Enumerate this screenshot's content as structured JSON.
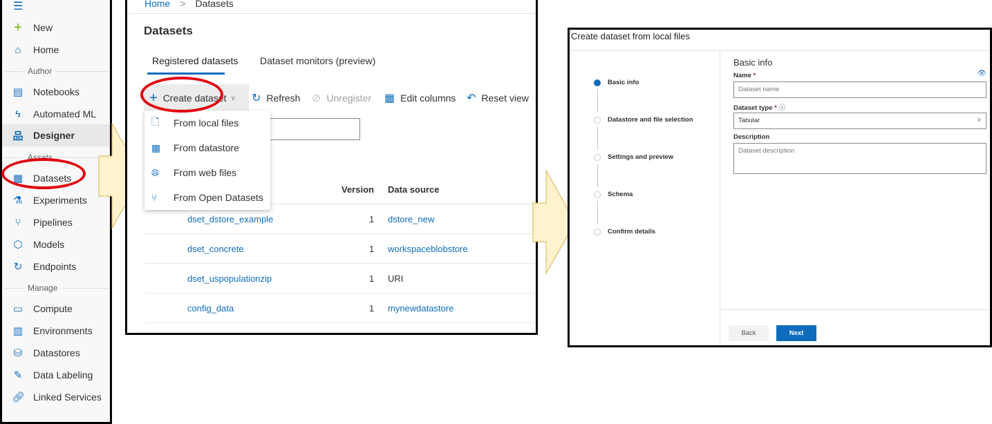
{
  "sidebar": {
    "items": [
      {
        "label": "New",
        "icon": "plus-icon"
      },
      {
        "label": "Home",
        "icon": "home-icon"
      },
      {
        "label": "Notebooks",
        "icon": "notebook-icon"
      },
      {
        "label": "Automated ML",
        "icon": "automl-icon"
      },
      {
        "label": "Designer",
        "icon": "designer-icon"
      },
      {
        "label": "Datasets",
        "icon": "datasets-icon"
      },
      {
        "label": "Experiments",
        "icon": "flask-icon"
      },
      {
        "label": "Pipelines",
        "icon": "pipeline-icon"
      },
      {
        "label": "Models",
        "icon": "cube-icon"
      },
      {
        "label": "Endpoints",
        "icon": "endpoint-icon"
      },
      {
        "label": "Compute",
        "icon": "monitor-icon"
      },
      {
        "label": "Environments",
        "icon": "environment-icon"
      },
      {
        "label": "Datastores",
        "icon": "database-icon"
      },
      {
        "label": "Data Labeling",
        "icon": "label-icon"
      },
      {
        "label": "Linked Services",
        "icon": "link-icon"
      }
    ],
    "sections": {
      "author": "Author",
      "assets": "Assets",
      "manage": "Manage"
    }
  },
  "breadcrumb": {
    "home": "Home",
    "sep": ">",
    "current": "Datasets"
  },
  "main": {
    "title": "Datasets",
    "tabs": [
      {
        "label": "Registered datasets"
      },
      {
        "label": "Dataset monitors (preview)"
      }
    ],
    "toolbar": {
      "create": "Create dataset",
      "refresh": "Refresh",
      "unregister": "Unregister",
      "edit_columns": "Edit columns",
      "reset_view": "Reset view"
    },
    "create_menu": [
      {
        "label": "From local files"
      },
      {
        "label": "From datastore"
      },
      {
        "label": "From web files"
      },
      {
        "label": "From Open Datasets"
      }
    ],
    "table": {
      "columns": {
        "version": "Version",
        "source": "Data source"
      },
      "rows": [
        {
          "name": "dset_dstore_example",
          "version": "1",
          "source": "dstore_new"
        },
        {
          "name": "dset_concrete",
          "version": "1",
          "source": "workspaceblobstore"
        },
        {
          "name": "dset_uspopulationzip",
          "version": "1",
          "source": "URI"
        },
        {
          "name": "config_data",
          "version": "1",
          "source": "mynewdatastore"
        }
      ]
    }
  },
  "wizard": {
    "title": "Create dataset from local files",
    "steps": [
      {
        "label": "Basic info",
        "active": true
      },
      {
        "label": "Datastore and file selection"
      },
      {
        "label": "Settings and preview"
      },
      {
        "label": "Schema"
      },
      {
        "label": "Confirm details"
      }
    ],
    "section_title": "Basic info",
    "name_label": "Name",
    "required": "*",
    "name_placeholder": "Dataset name",
    "type_label": "Dataset type",
    "type_value": "Tabular",
    "desc_label": "Description",
    "desc_placeholder": "Dataset description",
    "back": "Back",
    "next": "Next"
  },
  "colors": {
    "accent": "#0f6cbd",
    "highlight": "#e0000f",
    "arrow": "#fff2cc"
  }
}
